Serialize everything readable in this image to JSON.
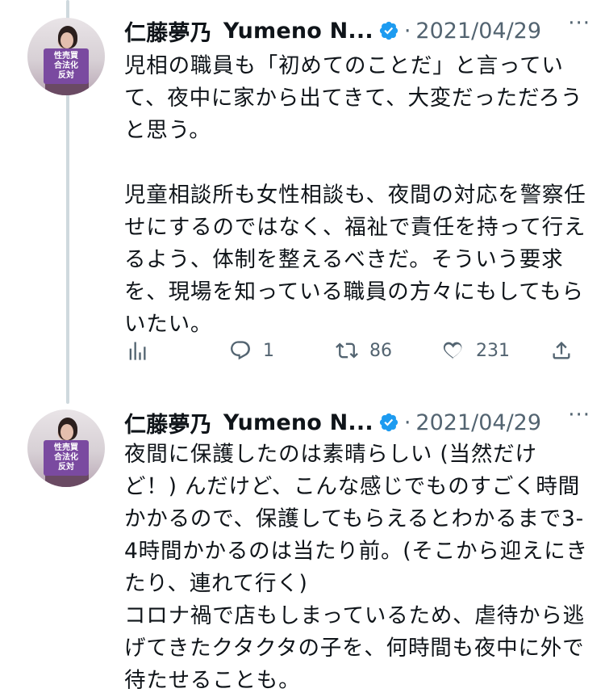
{
  "thread": [
    {
      "author": {
        "display_name": "仁藤夢乃",
        "name_truncated": "Yumeno N...",
        "verified": true,
        "avatar_sign_lines": [
          "性売買",
          "合法化",
          "反対"
        ]
      },
      "separator": "·",
      "date": "2021/04/29",
      "more_icon": "···",
      "text": "児相の職員も「初めてのことだ」と言っていて、夜中に家から出てきて、大変だっただろうと思う。\n\n児童相談所も女性相談も、夜間の対応を警察任せにするのではなく、福祉で責任を持って行えるよう、体制を整えるべきだ。そういう要求を、現場を知っている職員の方々にもしてもらいたい。",
      "actions": {
        "views_icon": "analytics-icon",
        "reply_count": "1",
        "retweet_count": "86",
        "like_count": "231",
        "share_icon": "share-icon"
      }
    },
    {
      "author": {
        "display_name": "仁藤夢乃",
        "name_truncated": "Yumeno N...",
        "verified": true,
        "avatar_sign_lines": [
          "性売買",
          "合法化",
          "反対"
        ]
      },
      "separator": "·",
      "date": "2021/04/29",
      "more_icon": "···",
      "text": "夜間に保護したのは素晴らしい (当然だけど！) んだけど、こんな感じでものすごく時間かかるので、保護してもらえるとわかるまで3-4時間かかるのは当たり前。(そこから迎えにきたり、連れて行く)\nコロナ禍で店もしまっているため、虐待から逃げてきたクタクタの子を、何時間も夜中に外で待たせることも。"
    }
  ],
  "colors": {
    "text": "#0f1419",
    "secondary": "#536471",
    "verified": "#1d9bf0",
    "thread_line": "#cfd9de"
  }
}
